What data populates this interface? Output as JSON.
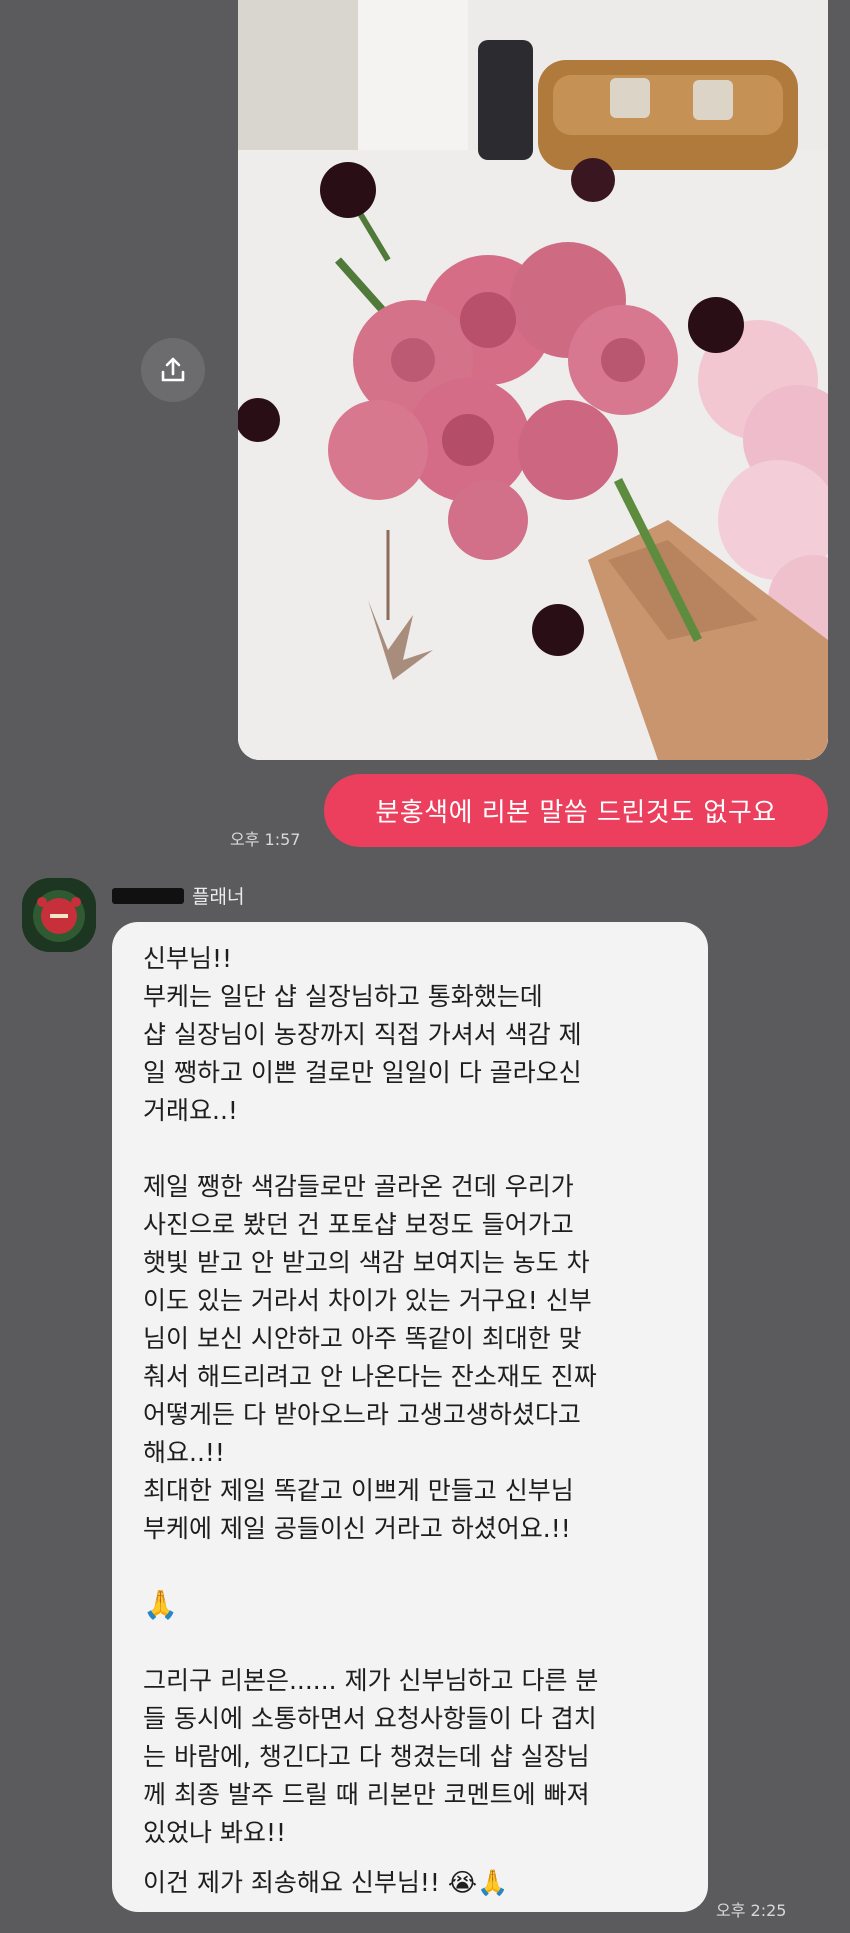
{
  "photo": {
    "description_icon": "bouquet-photo"
  },
  "sent": {
    "text": "분홍색에 리본 말씀 드린것도 없구요",
    "time": "오후 1:57"
  },
  "received": {
    "sender": "플래너",
    "time": "오후 2:25",
    "lines": {
      "l1": "신부님!!",
      "l2": "부케는 일단 샵 실장님하고 통화했는데",
      "l3": "샵 실장님이 농장까지 직접 가셔서 색감 제",
      "l4": "일 쨍하고 이쁜 걸로만 일일이 다 골라오신",
      "l5": "거래요..!",
      "l6": "제일 쨍한 색감들로만 골라온 건데 우리가",
      "l7": "사진으로 봤던 건 포토샵 보정도 들어가고",
      "l8": "햇빛 받고 안 받고의 색감 보여지는 농도 차",
      "l9": "이도 있는 거라서 차이가 있는 거구요! 신부",
      "l10": "님이 보신 시안하고 아주 똑같이 최대한 맞",
      "l11": "춰서 해드리려고 안 나온다는 잔소재도 진짜",
      "l12": "어떻게든 다 받아오느라 고생고생하셨다고",
      "l13": "해요..!!",
      "l14": "최대한 제일 똑같고 이쁘게 만들고 신부님",
      "l15": "부케에 제일 공들이신 거라고 하셨어요.!!",
      "l16": "🙏",
      "l17": "그리구 리본은...... 제가 신부님하고 다른 분",
      "l18": "들 동시에 소통하면서 요청사항들이 다 겹치",
      "l19": "는 바람에, 챙긴다고 다 챙겼는데 샵 실장님",
      "l20": "께 최종 발주 드릴 때 리본만 코멘트에 빠져",
      "l21": "있었나 봐요!!",
      "l22": "이건 제가 죄송해요 신부님!! 😭🙏"
    }
  }
}
